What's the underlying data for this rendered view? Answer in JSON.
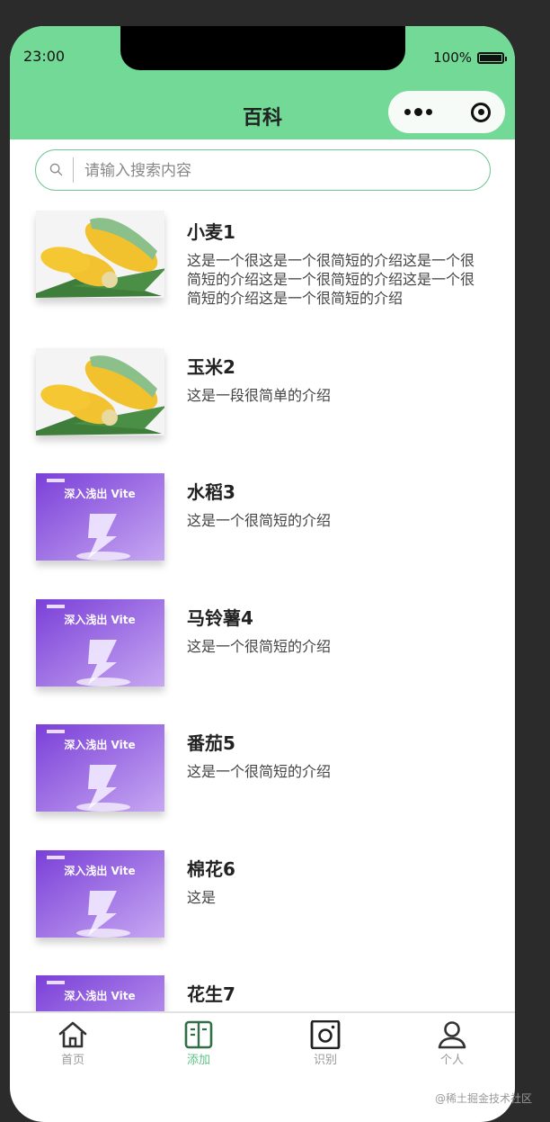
{
  "status": {
    "time": "23:00",
    "battery": "100%"
  },
  "header": {
    "title": "百科"
  },
  "search": {
    "placeholder": "请输入搜索内容"
  },
  "items": [
    {
      "name": "小麦1",
      "desc": "这是一个很这是一个很简短的介绍这是一个很简短的介绍这是一个很简短的介绍这是一个很简短的介绍这是一个很简短的介绍",
      "thumb": "corn"
    },
    {
      "name": "玉米2",
      "desc": "这是一段很简单的介绍",
      "thumb": "corn"
    },
    {
      "name": "水稻3",
      "desc": "这是一个很简短的介绍",
      "thumb": "vite",
      "thumb_text": "深入浅出 Vite"
    },
    {
      "name": "马铃薯4",
      "desc": "这是一个很简短的介绍",
      "thumb": "vite",
      "thumb_text": "深入浅出 Vite"
    },
    {
      "name": "番茄5",
      "desc": "这是一个很简短的介绍",
      "thumb": "vite",
      "thumb_text": "深入浅出 Vite"
    },
    {
      "name": "棉花6",
      "desc": "这是",
      "thumb": "vite",
      "thumb_text": "深入浅出 Vite"
    },
    {
      "name": "花生7",
      "desc": "",
      "thumb": "vite",
      "thumb_text": "深入浅出 Vite"
    }
  ],
  "tabbar": [
    {
      "label": "首页",
      "icon": "home-icon",
      "active": false
    },
    {
      "label": "添加",
      "icon": "book-icon",
      "active": true
    },
    {
      "label": "识别",
      "icon": "camera-icon",
      "active": false
    },
    {
      "label": "个人",
      "icon": "user-icon",
      "active": false
    }
  ],
  "watermark": "@稀土掘金技术社区",
  "colors": {
    "header_bg": "#72d996",
    "accent": "#5cc187"
  }
}
